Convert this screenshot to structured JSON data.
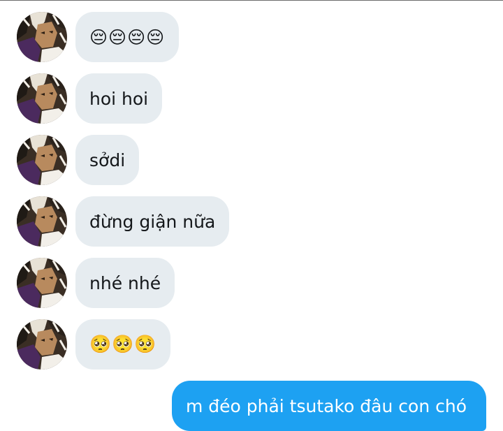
{
  "conversation": {
    "received": [
      {
        "text": "😔😔😔😔",
        "kind": "emoji"
      },
      {
        "text": "hoi hoi",
        "kind": "text"
      },
      {
        "text": "sởdi",
        "kind": "text"
      },
      {
        "text": "đừng giận nữa",
        "kind": "text"
      },
      {
        "text": "nhé nhé",
        "kind": "text"
      },
      {
        "text": "🥺🥺🥺",
        "kind": "emoji"
      }
    ],
    "sent": [
      {
        "text": "m đéo phải tsutako đâu con chó"
      }
    ]
  },
  "colors": {
    "received_bubble": "#e6ecf0",
    "received_text": "#14171a",
    "sent_bubble": "#1da1f2",
    "sent_text": "#ffffff"
  },
  "icons": {
    "avatar": "anime-character-avatar-icon"
  }
}
